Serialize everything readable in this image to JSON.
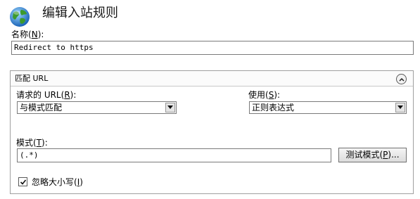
{
  "header": {
    "title": "编辑入站规则",
    "icon": "globe-icon"
  },
  "name_field": {
    "label": "名称",
    "accel": "N",
    "value": "Redirect to https"
  },
  "match_group": {
    "title": "匹配 URL",
    "collapse_icon": "chevron-up-icon",
    "requested_url": {
      "label": "请求的 URL",
      "accel": "R",
      "value": "与模式匹配"
    },
    "using": {
      "label": "使用",
      "accel": "S",
      "value": "正则表达式"
    },
    "pattern": {
      "label": "模式",
      "accel": "T",
      "value": "(.*)"
    },
    "test_button": {
      "label": "测试模式",
      "accel": "P"
    },
    "ignore_case": {
      "label": "忽略大小写",
      "accel": "I",
      "checked": true
    }
  },
  "colors": {
    "border": "#7a7a7a",
    "group_border": "#a0a0a0"
  }
}
